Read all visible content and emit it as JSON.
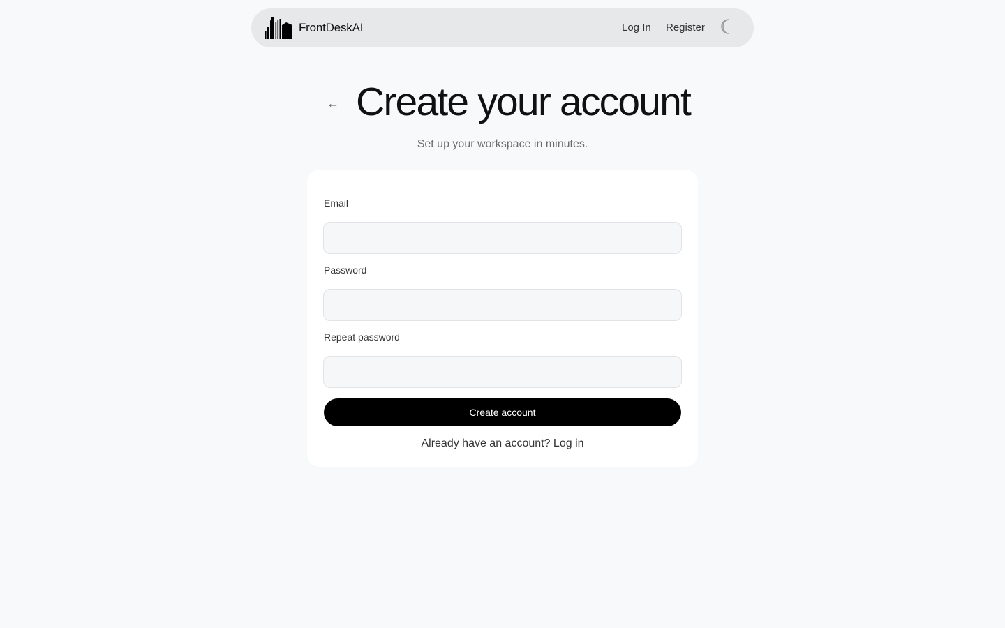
{
  "header": {
    "brand_name": "FrontDeskAI",
    "logo_icon": "city-buildings-icon",
    "login_label": "Log In",
    "register_label": "Register",
    "theme_icon": "moon-icon"
  },
  "main": {
    "back_icon": "←",
    "title": "Create your account",
    "subtitle": "Set up your workspace in minutes."
  },
  "form": {
    "email_label": "Email",
    "email_value": "",
    "password_label": "Password",
    "password_value": "",
    "repeat_password_label": "Repeat password",
    "repeat_password_value": "",
    "submit_label": "Create account",
    "login_prompt": "Already have an account? Log in"
  },
  "colors": {
    "background": "#f8f9fb",
    "navbar": "#e7e8ea",
    "card": "#ffffff",
    "button": "#000000",
    "input_background": "#f6f7f9"
  }
}
